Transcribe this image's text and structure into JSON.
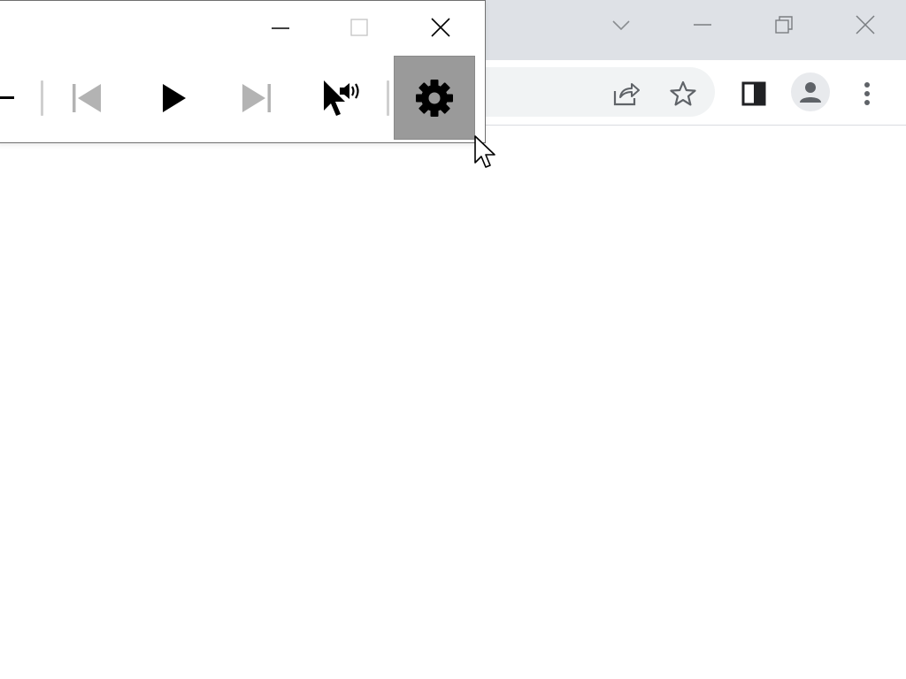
{
  "browser": {
    "controls": {
      "tab_search": "chevron-down-icon",
      "minimize": "minimize-icon",
      "restore": "restore-icon",
      "close": "close-icon"
    },
    "toolbar": {
      "share": "share-icon",
      "bookmark": "star-icon",
      "side_panel": "side-panel-icon",
      "profile": "profile-icon",
      "menu": "kebab-menu-icon"
    },
    "colors": {
      "titlebar": "#dee1e6",
      "omnibox": "#f1f3f4",
      "icon": "#5f6368"
    }
  },
  "player": {
    "controls": {
      "minimize": "minimize-icon",
      "maximize": "maximize-icon",
      "close": "close-icon"
    },
    "toolbar": {
      "previous": "skip-previous-icon",
      "play": "play-icon",
      "next": "skip-next-icon",
      "read_from_pointer": "pointer-speak-icon",
      "settings": "gear-icon"
    },
    "colors": {
      "settings_hover_bg": "#9a9a9a",
      "disabled_icon": "#b3b3b3",
      "separator": "#cfcfcf"
    }
  }
}
